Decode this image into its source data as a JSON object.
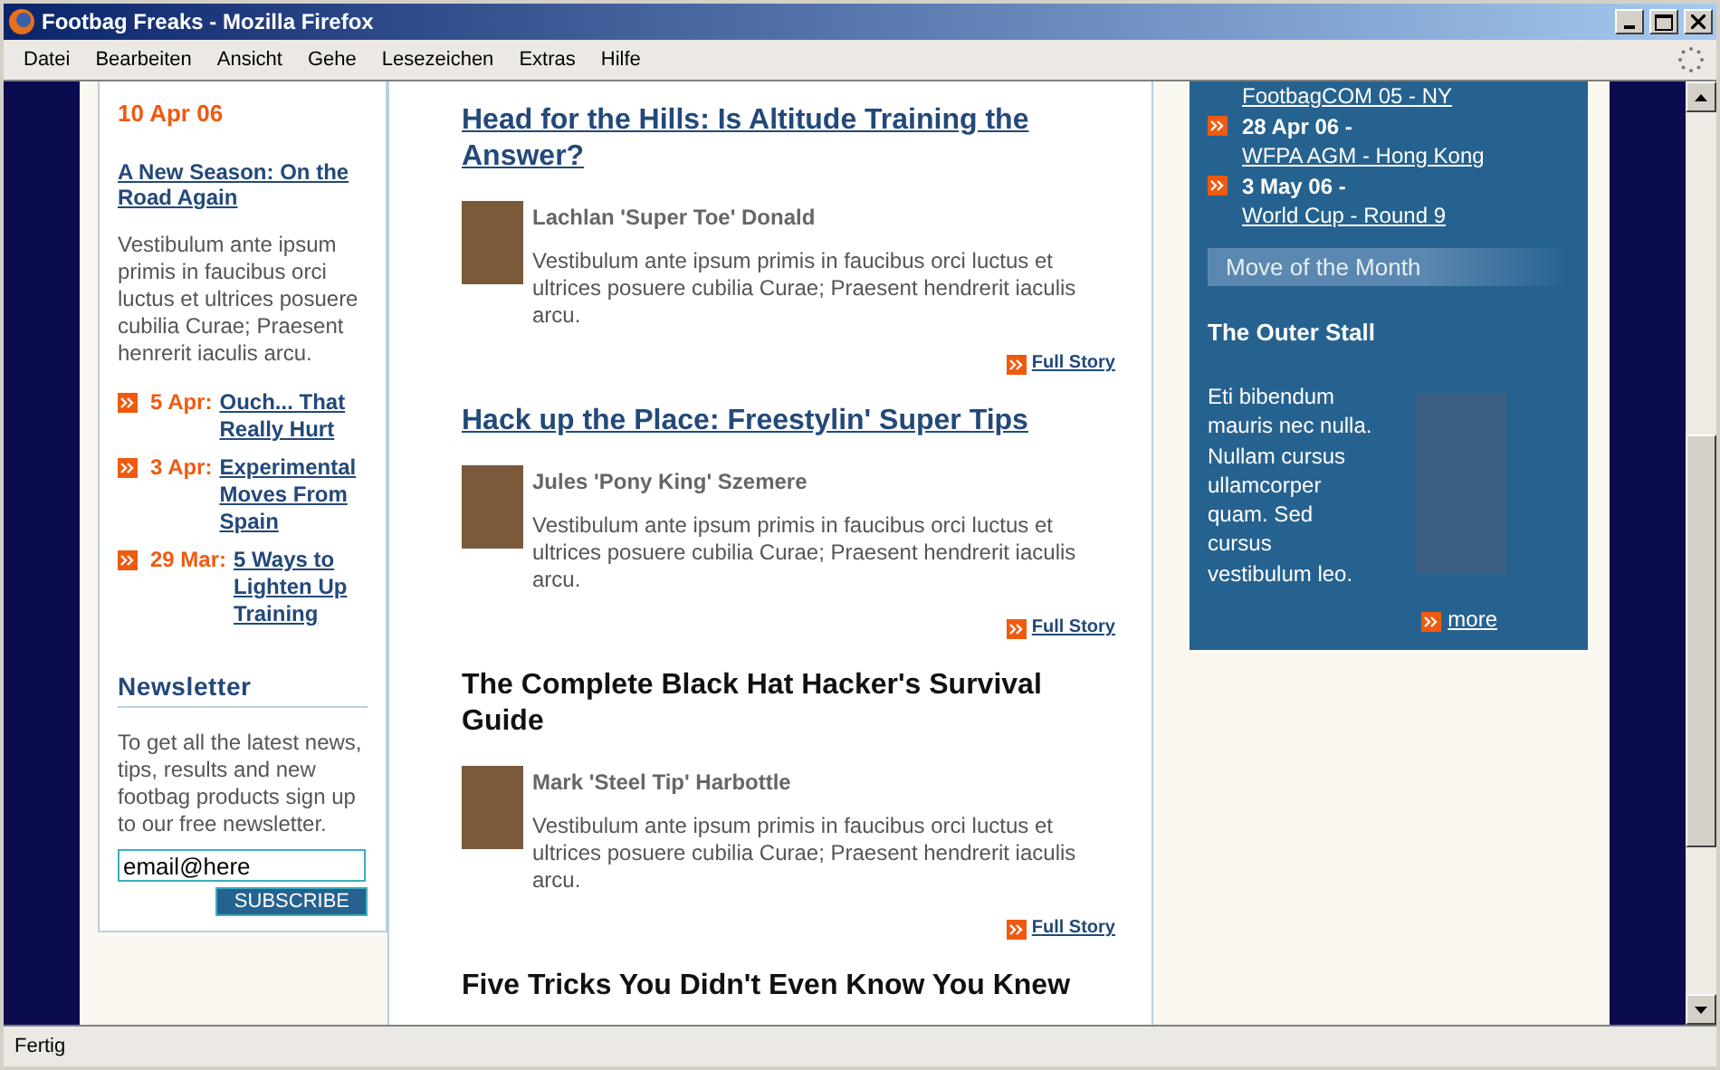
{
  "window": {
    "title": "Footbag Freaks - Mozilla Firefox"
  },
  "menu": [
    "Datei",
    "Bearbeiten",
    "Ansicht",
    "Gehe",
    "Lesezeichen",
    "Extras",
    "Hilfe"
  ],
  "left": {
    "date": "10 Apr 06",
    "feature": {
      "title": "A New Season: On the Road Again",
      "body": "Vestibulum ante ipsum primis in faucibus orci luctus et ultrices posuere cubilia Curae; Praesent henrerit iaculis arcu."
    },
    "news": [
      {
        "date": "5 Apr:",
        "title": "Ouch... That Really Hurt"
      },
      {
        "date": "3 Apr:",
        "title": "Experimental Moves From Spain"
      },
      {
        "date": "29 Mar:",
        "title": "5 Ways to Lighten Up Training"
      }
    ],
    "newsletter": {
      "heading": "Newsletter",
      "text": "To get all the latest news, tips, results and new footbag products sign up to our free newsletter.",
      "email_value": "email@here",
      "button": "SUBSCRIBE"
    }
  },
  "articles": [
    {
      "title": "Head for the Hills: Is Altitude Training the Answer?",
      "linked": true,
      "author": "Lachlan 'Super Toe' Donald",
      "body": "Vestibulum ante ipsum primis in faucibus orci luctus et ultrices posuere cubilia Curae; Praesent hendrerit iaculis arcu.",
      "link": "Full Story"
    },
    {
      "title": "Hack up the Place: Freestylin' Super Tips",
      "linked": true,
      "author": "Jules 'Pony King' Szemere",
      "body": "Vestibulum ante ipsum primis in faucibus orci luctus et ultrices posuere cubilia Curae; Praesent hendrerit iaculis arcu.",
      "link": "Full Story"
    },
    {
      "title": "The Complete Black Hat Hacker's Survival Guide",
      "linked": false,
      "author": "Mark 'Steel Tip' Harbottle",
      "body": "Vestibulum ante ipsum primis in faucibus orci luctus et ultrices posuere cubilia Curae; Praesent hendrerit iaculis arcu.",
      "link": "Full Story"
    },
    {
      "title": "Five Tricks You Didn't Even Know You Knew",
      "linked": false
    }
  ],
  "right": {
    "events": [
      {
        "title": "FootbagCOM 05 - NY"
      },
      {
        "date": "28 Apr 06 -",
        "title": "WFPA AGM - Hong Kong"
      },
      {
        "date": "3 May 06 -",
        "title": "World Cup - Round 9"
      }
    ],
    "move": {
      "heading": "Move of the Month",
      "title": "The Outer Stall",
      "body": "Eti bibendum mauris nec nulla. Nullam cursus ullamcorper quam. Sed cursus vestibulum leo.",
      "link": "more"
    }
  },
  "status_bar": "Fertig"
}
